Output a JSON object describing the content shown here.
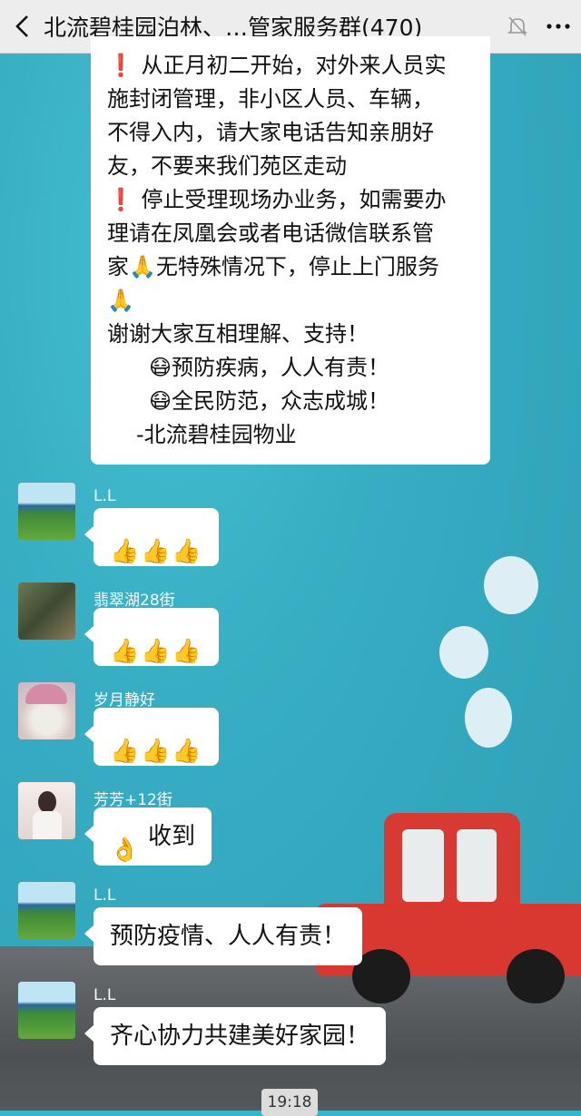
{
  "header": {
    "title": "北流碧桂园泊林、…管家服务群(470)"
  },
  "announcement": {
    "lines": [
      "从正月初二开始，对外来人员实",
      "施封闭管理，非小区人员、车辆，",
      "不得入内，请大家电话告知亲朋好",
      "友，不要来我们苑区走动",
      "停止受理现场办业务，如需要办",
      "理请在凤凰会或者电话微信联系管",
      "家",
      "无特殊情况下，停止上门服务",
      "谢谢大家互相理解、支持！",
      "预防疾病，人人有责！",
      "全民防范，众志成城！",
      "-北流碧桂园物业"
    ]
  },
  "messages": [
    {
      "sender": "L.L"
    },
    {
      "sender": "翡翠湖28街"
    },
    {
      "sender": "岁月静好"
    },
    {
      "sender": "芳芳+12街",
      "text": "收到"
    },
    {
      "sender": "L.L",
      "text": "预防疫情、人人有责！"
    },
    {
      "sender": "L.L",
      "text": "齐心协力共建美好家园！"
    }
  ],
  "timestamp": "19:18",
  "colors": {
    "excl": "#e02020",
    "bubble": "#ffffff",
    "topbar": "#ededed"
  }
}
